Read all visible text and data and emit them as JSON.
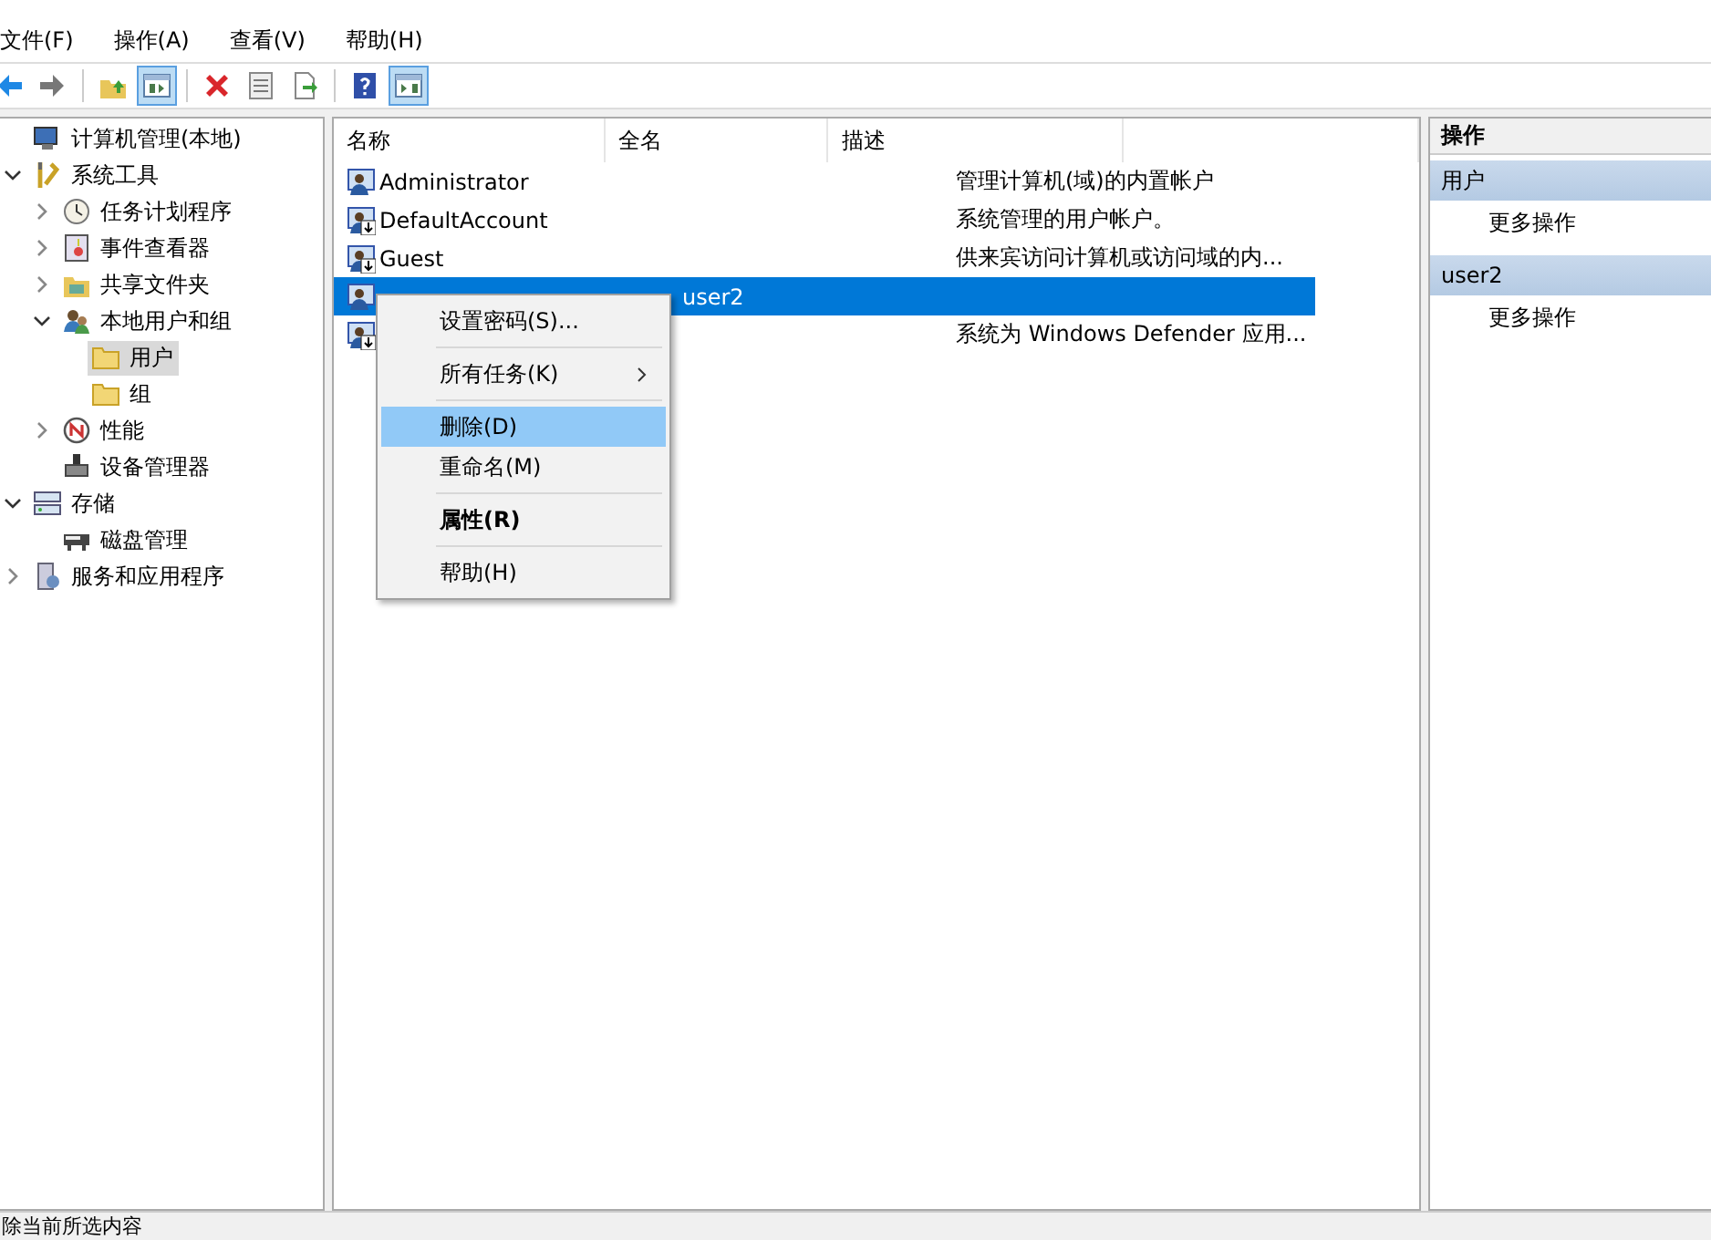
{
  "menu_bar": [
    "文件(F)",
    "操作(A)",
    "查看(V)",
    "帮助(H)"
  ],
  "toolbar": [
    {
      "kind": "back",
      "pressed": false
    },
    {
      "kind": "forward",
      "pressed": false
    },
    {
      "kind": "separator"
    },
    {
      "kind": "up",
      "pressed": false
    },
    {
      "kind": "tree",
      "pressed": true
    },
    {
      "kind": "separator"
    },
    {
      "kind": "delete",
      "pressed": false
    },
    {
      "kind": "properties",
      "pressed": false
    },
    {
      "kind": "export",
      "pressed": false
    },
    {
      "kind": "separator"
    },
    {
      "kind": "help",
      "pressed": false
    },
    {
      "kind": "actionpane",
      "pressed": true
    }
  ],
  "tree": [
    {
      "label": "计算机管理(本地)",
      "kind": "computer",
      "selected": false,
      "children": [
        {
          "label": "系统工具",
          "kind": "tools",
          "expanded": true,
          "selected": false,
          "children": [
            {
              "label": "任务计划程序",
              "kind": "clock",
              "expanded": false,
              "selected": false
            },
            {
              "label": "事件查看器",
              "kind": "event",
              "expanded": false,
              "selected": false
            },
            {
              "label": "共享文件夹",
              "kind": "share",
              "expanded": false,
              "selected": false
            },
            {
              "label": "本地用户和组",
              "kind": "users",
              "expanded": true,
              "selected": false,
              "children": [
                {
                  "label": "用户",
                  "kind": "folder",
                  "selected": true
                },
                {
                  "label": "组",
                  "kind": "folder",
                  "selected": false
                }
              ]
            },
            {
              "label": "性能",
              "kind": "perf",
              "expanded": false,
              "selected": false
            },
            {
              "label": "设备管理器",
              "kind": "device",
              "selected": false
            }
          ]
        },
        {
          "label": "存储",
          "kind": "storage",
          "expanded": true,
          "selected": false,
          "children": [
            {
              "label": "磁盘管理",
              "kind": "disk",
              "selected": false
            }
          ]
        },
        {
          "label": "服务和应用程序",
          "kind": "services",
          "expanded": false,
          "selected": false
        }
      ]
    }
  ],
  "table": {
    "columns": [
      "名称",
      "全名",
      "描述"
    ],
    "rows": [
      {
        "name": "Administrator",
        "full_name": "",
        "description": "管理计算机(域)的内置帐户",
        "disabled": false,
        "selected": false
      },
      {
        "name": "DefaultAccount",
        "full_name": "",
        "description": "系统管理的用户帐户。",
        "disabled": true,
        "selected": false
      },
      {
        "name": "Guest",
        "full_name": "",
        "description": "供来宾访问计算机或访问域的内...",
        "disabled": true,
        "selected": false
      },
      {
        "name": "",
        "full_name": "user2",
        "description": "",
        "disabled": false,
        "selected": true
      },
      {
        "name": "",
        "full_name": "",
        "description": "系统为 Windows Defender 应用...",
        "disabled": true,
        "selected": false
      }
    ]
  },
  "context_menu": [
    {
      "kind": "item",
      "label": "设置密码(S)...",
      "submenu": false,
      "default": false,
      "selected": false
    },
    {
      "kind": "separator"
    },
    {
      "kind": "item",
      "label": "所有任务(K)",
      "submenu": true,
      "default": false,
      "selected": false
    },
    {
      "kind": "separator"
    },
    {
      "kind": "item",
      "label": "删除(D)",
      "submenu": false,
      "default": false,
      "selected": true
    },
    {
      "kind": "item",
      "label": "重命名(M)",
      "submenu": false,
      "default": false,
      "selected": false
    },
    {
      "kind": "separator"
    },
    {
      "kind": "item",
      "label": "属性(R)",
      "submenu": false,
      "default": true,
      "selected": false
    },
    {
      "kind": "separator"
    },
    {
      "kind": "item",
      "label": "帮助(H)",
      "submenu": false,
      "default": false,
      "selected": false
    }
  ],
  "actions": {
    "title": "操作",
    "sections": [
      {
        "title": "用户",
        "items": [
          "更多操作"
        ]
      },
      {
        "title": "user2",
        "items": [
          "更多操作"
        ]
      }
    ]
  },
  "status_bar": "除当前所选内容"
}
